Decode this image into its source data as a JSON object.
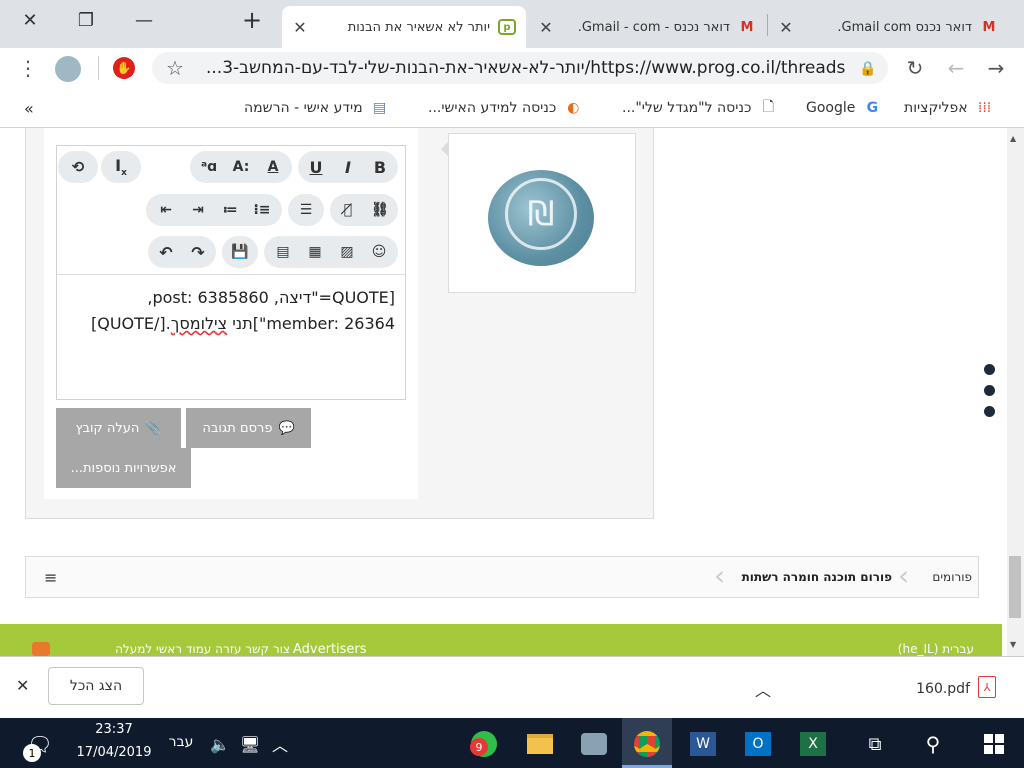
{
  "tabs": [
    {
      "title": "דואר נכנס Gmail com.",
      "icon": "gmail-icon"
    },
    {
      "title": "דואר נכנס - Gmail - com.",
      "icon": "gmail-icon"
    },
    {
      "title": "יותר לא אשאיר את הבנות",
      "icon": "prog-icon"
    }
  ],
  "toolbar": {
    "url": "https://www.prog.co.il/threads/יותר-לא-אשאיר-את-הבנות-שלי-לבד-עם-המחשב-3...",
    "new_tab": "+"
  },
  "bookmarks": [
    {
      "label": "אפליקציות",
      "icon": "apps-grid-icon"
    },
    {
      "label": "Google",
      "icon": "google-icon"
    },
    {
      "label": "כניסה ל\"מגדל שלי\"...",
      "icon": "page-icon"
    },
    {
      "label": "כניסה למידע האישי...",
      "icon": "swirl-icon"
    },
    {
      "label": "מידע אישי - הרשמה",
      "icon": "doc-icon"
    },
    {
      "label": "»",
      "icon": "overflow-icon"
    }
  ],
  "editor": {
    "line1": "[QUOTE=\"דיצה, post: 6385860,",
    "line2_pre": "member: 26364\"]תני ",
    "line2_spell": "צילומסך",
    "line2_post": ".[/QUOTE]"
  },
  "buttons": {
    "post_reply": "פרסם תגובה",
    "upload_file": "העלה קובץ",
    "more_options": "אפשרויות נוספות..."
  },
  "breadcrumb": {
    "forums": "פורומים",
    "current": "פורום תוכנה חומרה רשתות"
  },
  "footer": {
    "left": "צור קשר   עזרה   עמוד ראשי   למעלה",
    "advertisers": "Advertisers",
    "lang": "עברית (he_IL)"
  },
  "download": {
    "file": "160.pdf",
    "show_all": "הצג הכל"
  },
  "taskbar": {
    "time": "23:37",
    "date": "17/04/2019",
    "lang": "עבר",
    "badge": "9",
    "notif": "1"
  },
  "colors": {
    "tabstrip": "#dee1e6",
    "footer_green": "#a6c83b",
    "taskbar": "#0f1b2d",
    "button_gray": "#a7a7a7"
  }
}
